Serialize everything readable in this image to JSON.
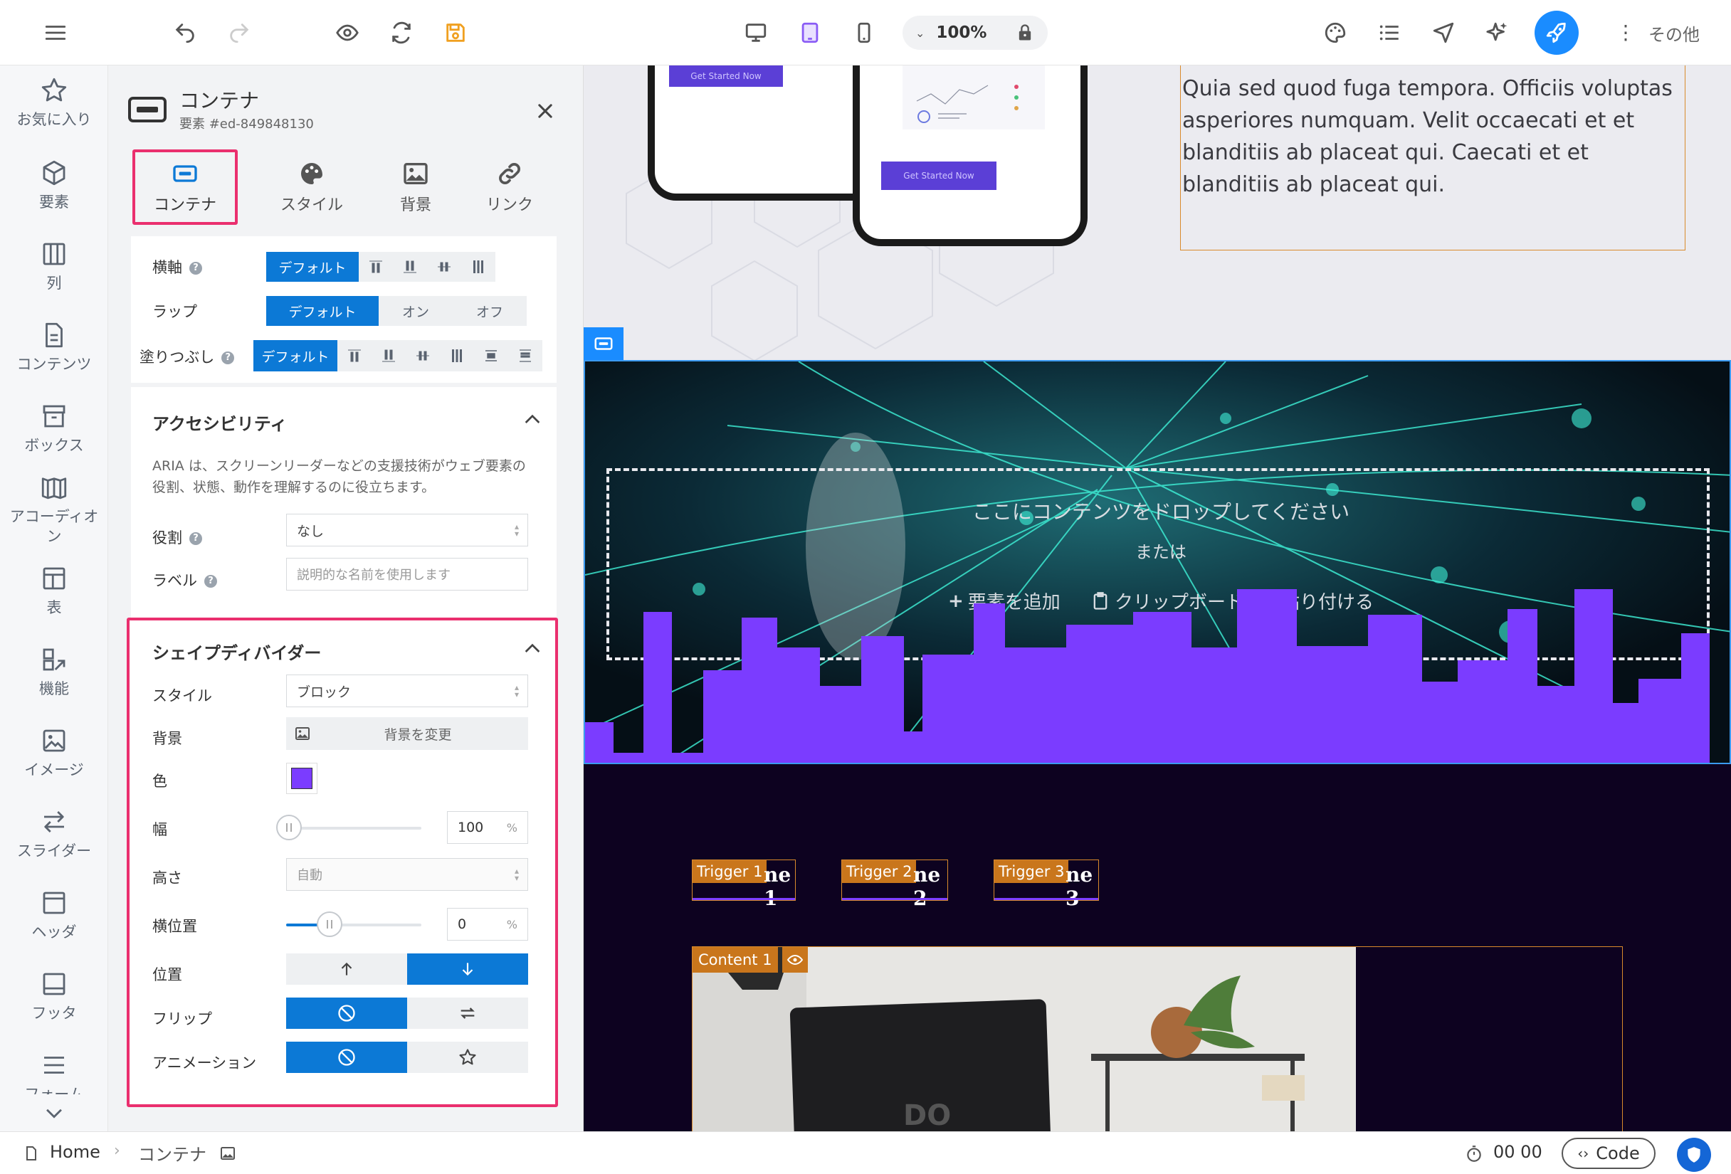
{
  "toolbar": {
    "zoom": "100%",
    "more_label": "その他"
  },
  "rail": [
    {
      "label": "お気に入り",
      "icon": "star-icon"
    },
    {
      "label": "要素",
      "icon": "cube-icon"
    },
    {
      "label": "列",
      "icon": "columns-icon"
    },
    {
      "label": "コンテンツ",
      "icon": "document-icon"
    },
    {
      "label": "ボックス",
      "icon": "box-icon"
    },
    {
      "label": "アコーディオン",
      "icon": "accordion-icon"
    },
    {
      "label": "表",
      "icon": "table-icon"
    },
    {
      "label": "機能",
      "icon": "features-icon"
    },
    {
      "label": "イメージ",
      "icon": "image-icon"
    },
    {
      "label": "スライダー",
      "icon": "slider-icon"
    },
    {
      "label": "ヘッダ",
      "icon": "header-icon"
    },
    {
      "label": "フッタ",
      "icon": "footer-icon"
    },
    {
      "label": "フォーム",
      "icon": "form-icon"
    }
  ],
  "panel": {
    "title": "コンテナ",
    "subtitle": "要素 #ed-849848130",
    "tabs": [
      {
        "label": "コンテナ",
        "icon": "container-icon",
        "active": true
      },
      {
        "label": "スタイル",
        "icon": "palette-icon"
      },
      {
        "label": "背景",
        "icon": "image-icon"
      },
      {
        "label": "リンク",
        "icon": "link-icon"
      }
    ],
    "layout": {
      "horizontal_label": "横軸",
      "wrap_label": "ラップ",
      "fill_label": "塗りつぶし",
      "default_label": "デフォルト",
      "on_label": "オン",
      "off_label": "オフ"
    },
    "accessibility": {
      "title": "アクセシビリティ",
      "description": "ARIA は、スクリーンリーダーなどの支援技術がウェブ要素の役割、状態、動作を理解するのに役立ちます。",
      "role_label": "役割",
      "role_value": "なし",
      "label_label": "ラベル",
      "label_placeholder": "説明的な名前を使用します"
    },
    "shape_divider": {
      "title": "シェイプディバイダー",
      "style_label": "スタイル",
      "style_value": "ブロック",
      "background_label": "背景",
      "background_button": "背景を変更",
      "color_label": "色",
      "color_value": "#7b3cff",
      "width_label": "幅",
      "width_value": "100",
      "width_unit": "%",
      "width_percent": 1.0,
      "height_label": "高さ",
      "height_value": "自動",
      "hpos_label": "横位置",
      "hpos_value": "0",
      "hpos_unit": "%",
      "hpos_fraction": 0.5,
      "position_label": "位置",
      "flip_label": "フリップ",
      "animation_label": "アニメーション"
    }
  },
  "canvas": {
    "lorem": "Quia sed quod fuga tempora. Officiis voluptas asperiores numquam. Velit occaecati et et blanditiis ab placeat qui. Caecati et et blanditiis ab placeat qui.",
    "get_started_1": "Get Started Now",
    "get_started_2": "Get Started Now",
    "drop_text": "ここにコンテンツをドロップしてください",
    "or_text": "または",
    "add_element": "要素を追加",
    "paste_clipboard": "クリップボードから貼り付ける",
    "triggers": [
      {
        "badge": "Trigger 1",
        "text": "ne 1"
      },
      {
        "badge": "Trigger 2",
        "text": "ne 2"
      },
      {
        "badge": "Trigger 3",
        "text": "ne 3"
      }
    ],
    "content_badge": "Content 1",
    "accent_purple": "#7b3cff",
    "accent_orange": "#d98a2c"
  },
  "bottombar": {
    "home": "Home",
    "crumb": "コンテナ",
    "time": "00 00",
    "code": "Code"
  }
}
